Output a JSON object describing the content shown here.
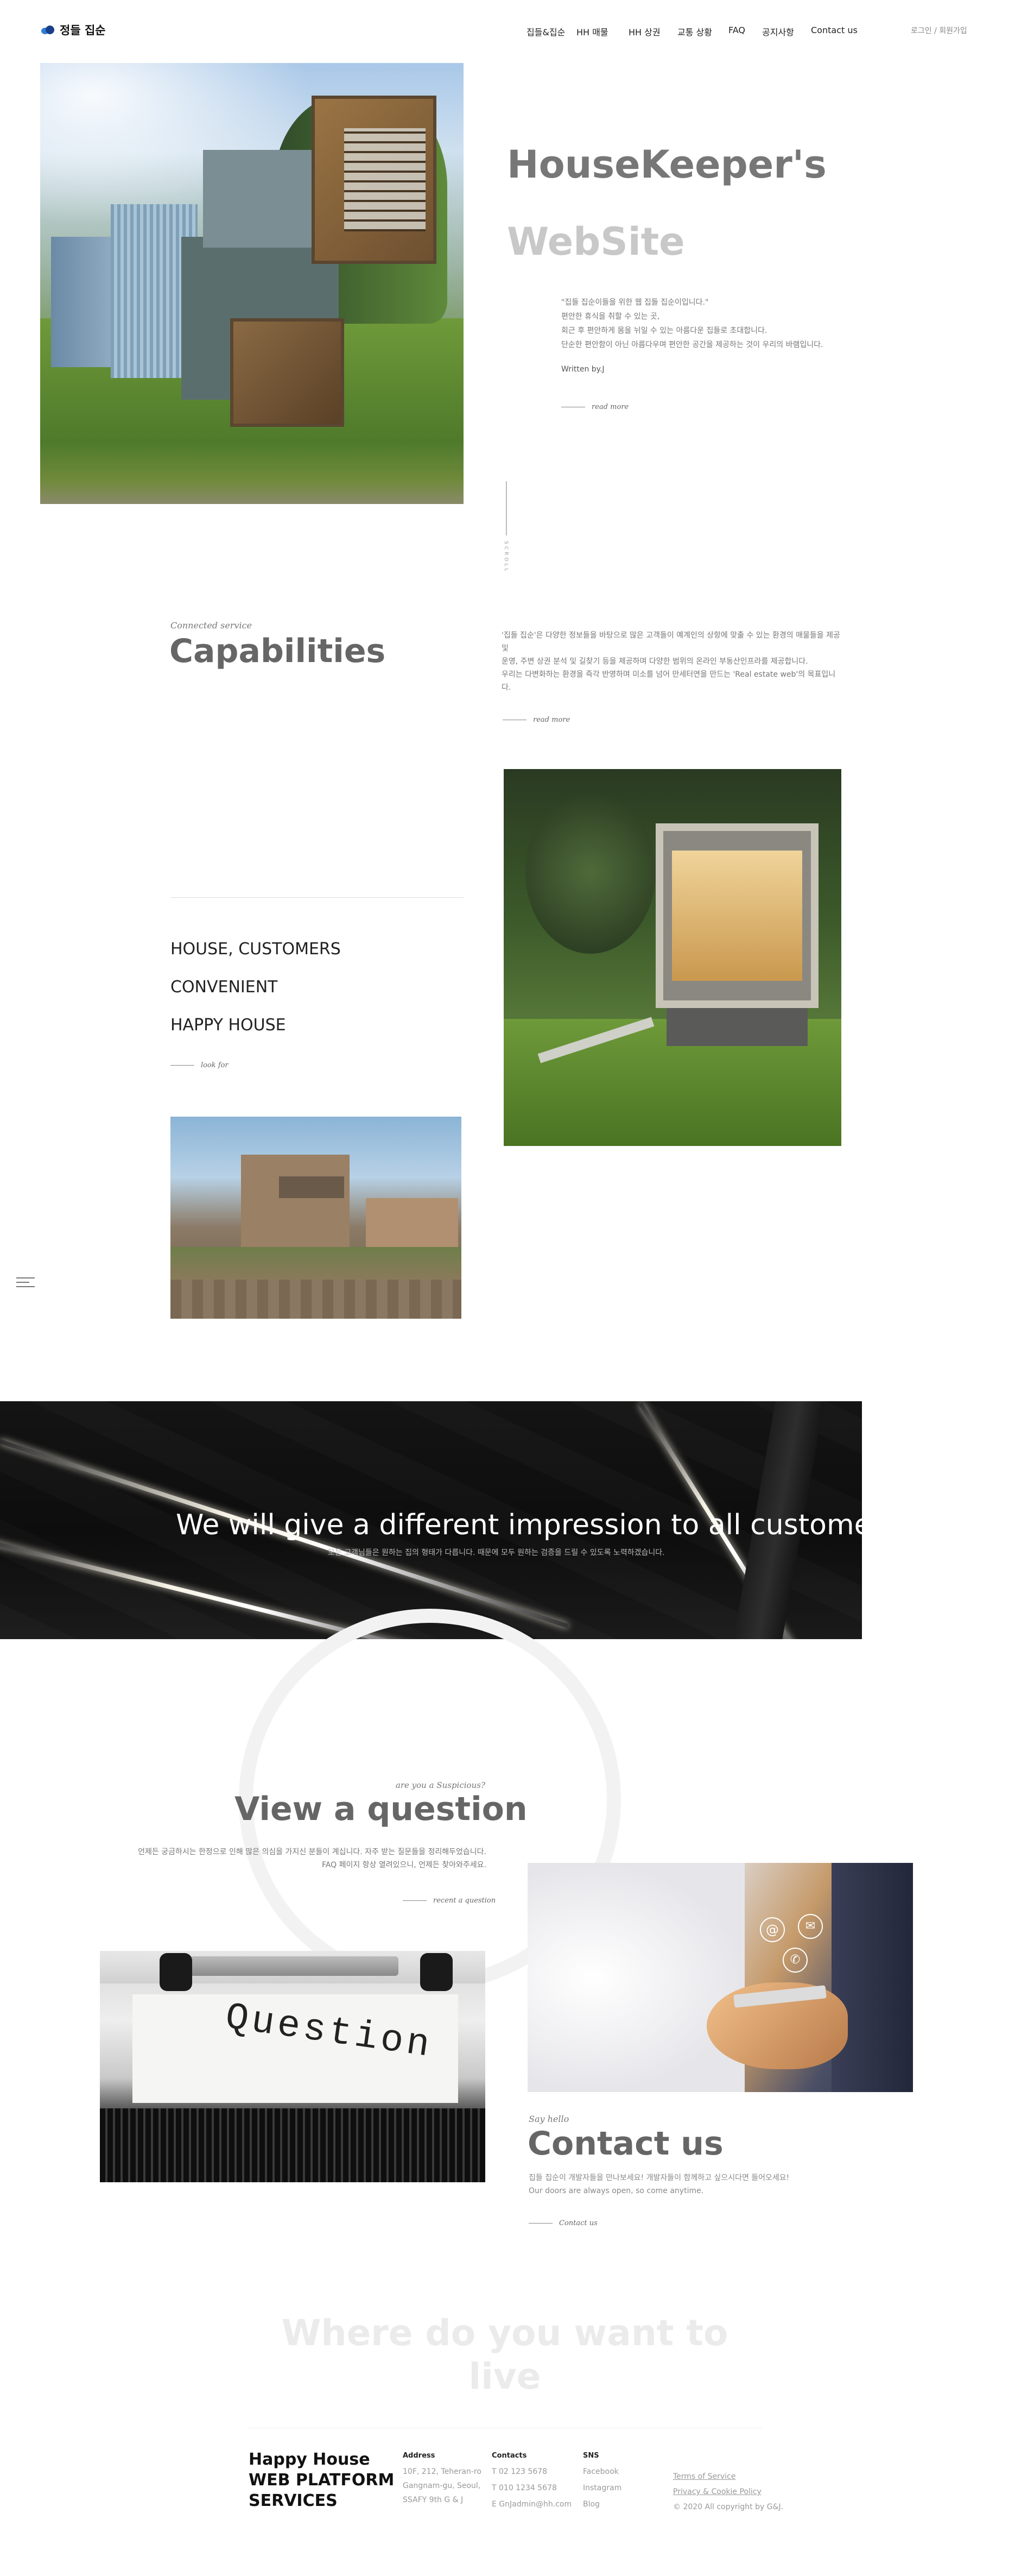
{
  "header": {
    "logo_text": "정들 집순",
    "nav": [
      "집들&집순",
      "HH 매물",
      "HH 상권",
      "교통 상황",
      "FAQ",
      "공지사항",
      "Contact us"
    ],
    "login_label": "로그인",
    "separator": "/",
    "signup_label": "회원가입"
  },
  "hero": {
    "title_line1": "HouseKeeper's",
    "title_line2": "WebSite",
    "quote_lines": [
      "\"집들 집순이들을 위한 웹 집들 집순이입니다.\"",
      "편안한 휴식을 취할 수 있는 곳,",
      "회근 후 편안하게 몸을 뉘일 수 있는 아름다운 집들로 초대합니다.",
      "단순한 편안함이 아닌 아름다우며 편안한 공간을 제공하는 것이 우리의 바램입니다."
    ],
    "written_by": "Written by.J",
    "read_more": "read more",
    "scroll_label": "SCROLL"
  },
  "capabilities": {
    "subtitle": "Connected service",
    "title": "Capabilities",
    "text_lines": [
      "'집들 집순'은 다양한 정보들을 바탕으로 많은 고객들이 예계인의 상항에 맞출 수 있는 환경의 매물들을 제공 및",
      "운영, 주변 상권 분석 및 길찾기 등을 제공하며 다양한 범위의 온라인 부동산인프라를 제공합니다.",
      "우리는 다변화하는 환경을 즉각 반영하며 미소를 넘어 만세터연을 만드는 'Real estate web'의 목표입니다."
    ],
    "read_more": "read more",
    "taglines": [
      "HOUSE, CUSTOMERS",
      "CONVENIENT",
      "HAPPY HOUSE"
    ],
    "look_for": "look for"
  },
  "banner": {
    "title": "We will give a different impression to all customers",
    "subtitle": "모든 고객님들은 원하는 집의 형태가 다릅니다. 때문에 모두 원하는 검증을 드릴 수 있도록 노력하겠습니다."
  },
  "question": {
    "subtitle": "are you a Suspicious?",
    "title": "View a question",
    "text_lines": [
      "언제든 궁금하시는 한정으로 인해 많은 의심을 가지신 분들이 계십니다. 자주 받는 질문들을 정리해두었습니다.",
      "FAQ 페이지 항상 열려있으니, 언제든 찾아와주세요."
    ],
    "link": "recent a question",
    "image_word": "Question"
  },
  "contact": {
    "subtitle": "Say hello",
    "title": "Contact us",
    "text_lines": [
      "집들 집순이 개발자들을 만나보세요! 개발자들이 함께하고 싶으시다면 들어오세요!",
      "Our doors are always open, so come anytime."
    ],
    "link": "Contact us"
  },
  "where": {
    "text": "Where do you want to live"
  },
  "footer": {
    "brand_lines": [
      "Happy House",
      "WEB PLATFORM",
      "SERVICES"
    ],
    "address": {
      "heading": "Address",
      "lines": [
        "10F, 212, Teheran-ro",
        "Gangnam-gu, Seoul,",
        "SSAFY 9th G & J"
      ]
    },
    "contacts": {
      "heading": "Contacts",
      "lines": [
        "T 02 123 5678",
        "T 010 1234 5678",
        "E GnJadmin@hh.com"
      ]
    },
    "sns": {
      "heading": "SNS",
      "lines": [
        "Facebook",
        "Instagram",
        "Blog"
      ]
    },
    "legal": [
      "Terms of Service",
      "Privacy & Cookie Policy"
    ],
    "copyright": "© 2020 All copyright by G&J."
  },
  "colors": {
    "title_gray": "#666666",
    "light_title": "#c8c8c8",
    "banner_bg": "#111111",
    "accent_logo": "#2f7fd6"
  },
  "icons": [
    "menu-icon",
    "mail-icon",
    "at-icon",
    "phone-icon"
  ]
}
